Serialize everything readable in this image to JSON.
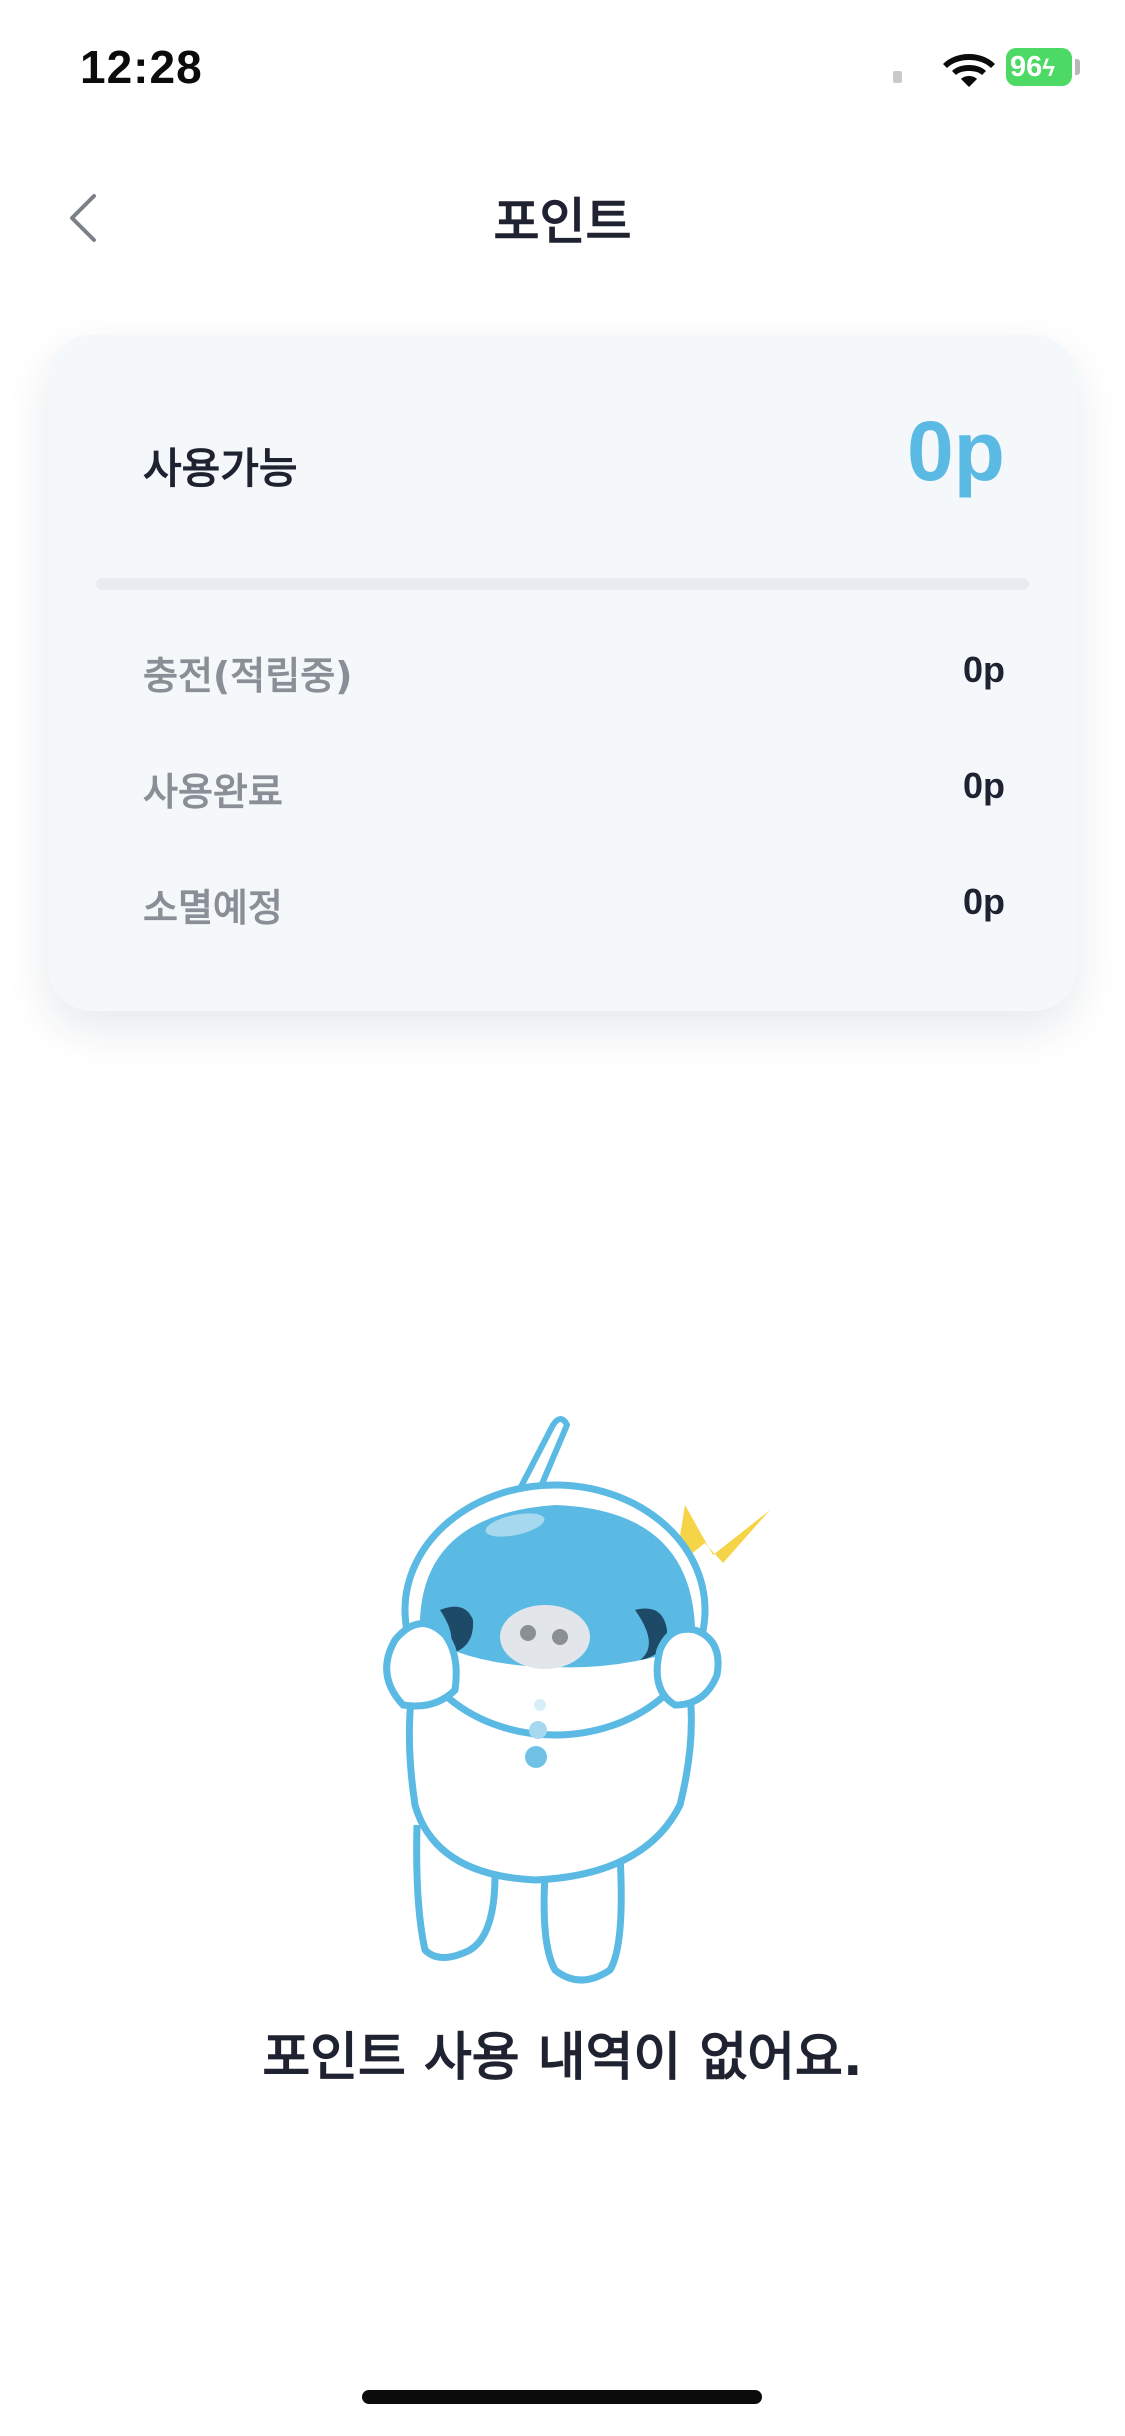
{
  "status_bar": {
    "time": "12:28",
    "battery": "96",
    "battery_charging": true
  },
  "header": {
    "title": "포인트",
    "back_icon": "chevron-left-icon"
  },
  "points_card": {
    "available_label": "사용가능",
    "available_value": "0p",
    "details": [
      {
        "label": "충전(적립중)",
        "value": "0p"
      },
      {
        "label": "사용완료",
        "value": "0p"
      },
      {
        "label": "소멸예정",
        "value": "0p"
      }
    ]
  },
  "empty_state": {
    "illustration": "mascot-illustration",
    "message": "포인트 사용 내역이 없어요."
  },
  "colors": {
    "accent": "#5bbae3",
    "card_background": "#f5f8fb",
    "text_primary": "#1f2230",
    "text_secondary": "#8a8e96",
    "battery": "#4cd964",
    "lightning": "#f5d547"
  }
}
